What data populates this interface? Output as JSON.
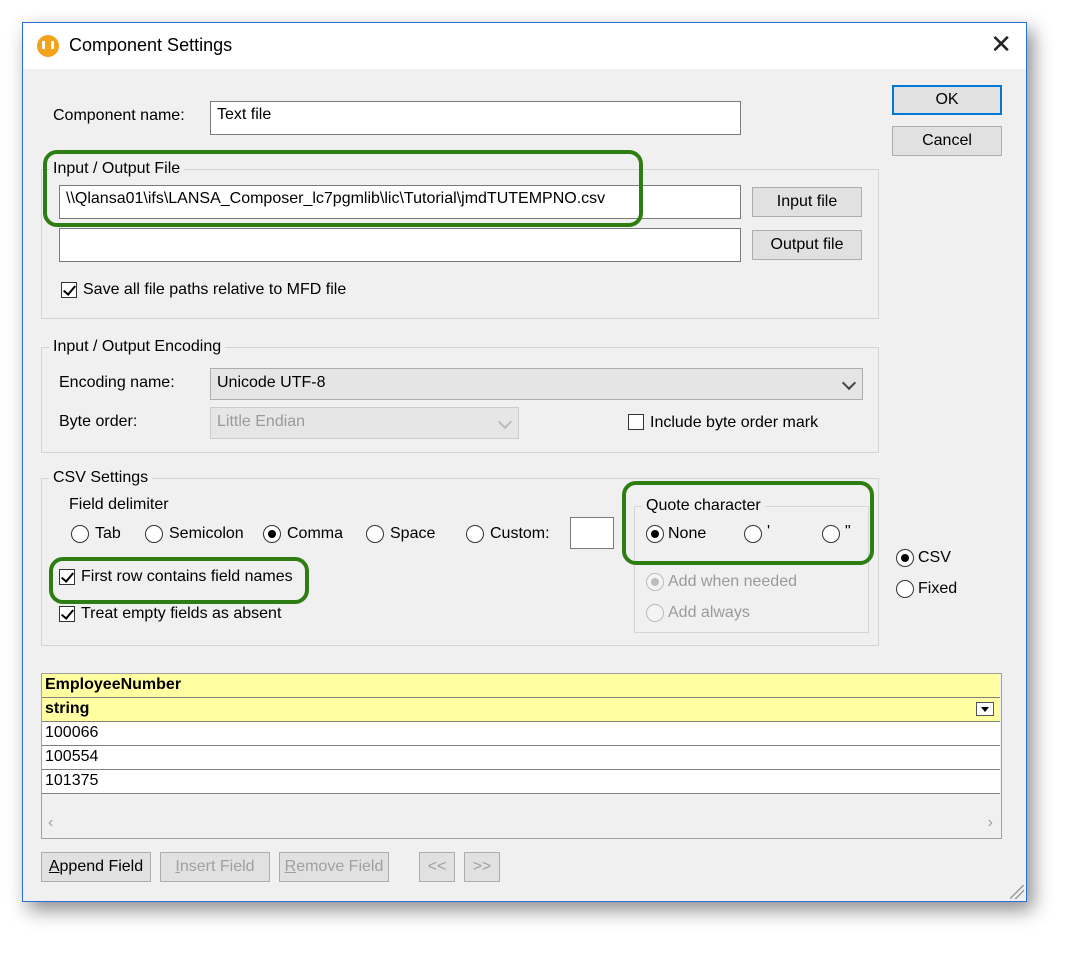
{
  "window": {
    "title": "Component Settings",
    "close": "✕"
  },
  "component": {
    "label": "Component name:",
    "value": "Text file"
  },
  "buttons": {
    "ok": "OK",
    "cancel": "Cancel"
  },
  "io_file": {
    "group_title": "Input / Output File",
    "input_path": "\\\\Qlansa01\\ifs\\LANSA_Composer_lc7pgmlib\\lic\\Tutorial\\jmdTUTEMPNO.csv",
    "output_path": "",
    "input_button": "Input file",
    "output_button": "Output file",
    "save_relative_label": "Save all file paths relative to MFD file",
    "save_relative_checked": true
  },
  "encoding": {
    "group_title": "Input / Output Encoding",
    "name_label": "Encoding name:",
    "name_value": "Unicode UTF-8",
    "byte_order_label": "Byte order:",
    "byte_order_value": "Little Endian",
    "bom_label": "Include byte order mark",
    "bom_checked": false
  },
  "csv": {
    "group_title": "CSV Settings",
    "field_delimiter": {
      "title": "Field delimiter",
      "options": [
        "Tab",
        "Semicolon",
        "Comma",
        "Space",
        "Custom:"
      ],
      "selected": "Comma",
      "custom_value": ""
    },
    "quote": {
      "title": "Quote character",
      "options": [
        "None",
        "'",
        "\""
      ],
      "selected": "None",
      "add_when_needed": "Add when needed",
      "add_always": "Add always"
    },
    "first_row_label": "First row contains field names",
    "first_row_checked": true,
    "treat_empty_label": "Treat empty fields as absent",
    "treat_empty_checked": true
  },
  "format": {
    "options": [
      "CSV",
      "Fixed"
    ],
    "selected": "CSV"
  },
  "grid": {
    "header": "EmployeeNumber",
    "type": "string",
    "rows": [
      "100066",
      "100554",
      "101375"
    ]
  },
  "bottom_buttons": {
    "append_first": "A",
    "append_rest": "ppend Field",
    "insert_first": "I",
    "insert_rest": "nsert Field",
    "remove_first": "R",
    "remove_rest": "emove Field",
    "prev": "<<",
    "next": ">>"
  }
}
